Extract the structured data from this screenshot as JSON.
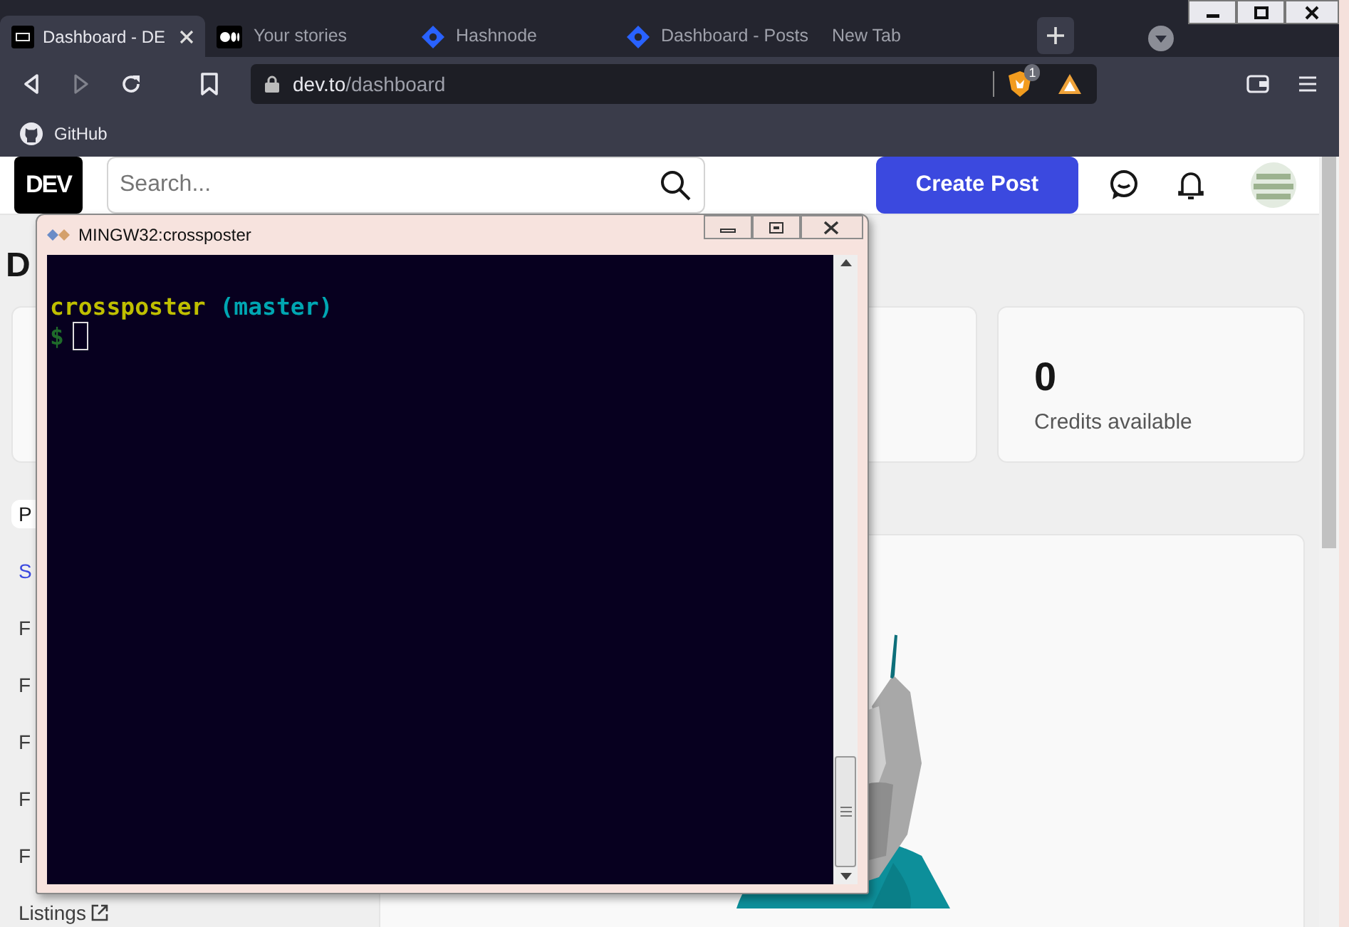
{
  "browser": {
    "tabs": [
      {
        "title": "Dashboard - DE",
        "selected": true,
        "kind": "dev"
      },
      {
        "title": "Your stories",
        "selected": false,
        "kind": "medium"
      },
      {
        "title": "Hashnode",
        "selected": false,
        "kind": "hashnode"
      },
      {
        "title": "Dashboard - Posts",
        "selected": false,
        "kind": "hashnode"
      },
      {
        "title": "New Tab",
        "selected": false,
        "kind": "blank"
      }
    ],
    "forward_disabled": true,
    "address": {
      "host": "dev.to",
      "path": "/dashboard"
    },
    "shields_count": "1",
    "bookmarks": [
      {
        "label": "GitHub"
      }
    ]
  },
  "page": {
    "logo": "DEV",
    "search": {
      "placeholder": "Search..."
    },
    "create_button": "Create Post",
    "heading": "D",
    "stats": [
      {
        "value": "0",
        "label": "Credits available"
      }
    ],
    "sidebar": [
      {
        "label": "P",
        "selected": true,
        "highlighted": false
      },
      {
        "label": "S",
        "selected": false,
        "highlighted": true
      },
      {
        "label": "F",
        "selected": false,
        "highlighted": false
      },
      {
        "label": "F",
        "selected": false,
        "highlighted": false
      },
      {
        "label": "F",
        "selected": false,
        "highlighted": false
      },
      {
        "label": "F",
        "selected": false,
        "highlighted": false
      },
      {
        "label": "F",
        "selected": false,
        "highlighted": false
      },
      {
        "label": "Listings",
        "selected": false,
        "highlighted": false,
        "external": true
      }
    ]
  },
  "terminal": {
    "title": "MINGW32:crossposter",
    "lines": [
      [
        {
          "text": "crossposter",
          "color": "#bfbf00"
        },
        {
          "text": "(master)",
          "color": "#00a6b2"
        }
      ]
    ],
    "prompt": "$"
  }
}
